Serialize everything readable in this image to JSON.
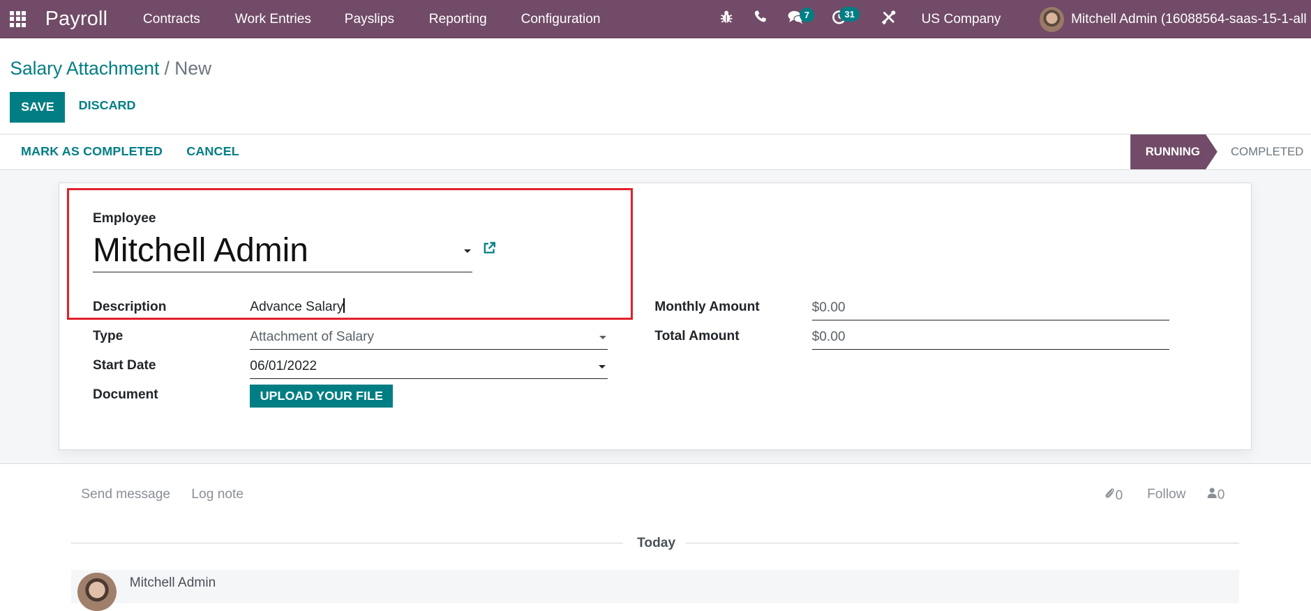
{
  "navbar": {
    "brand": "Payroll",
    "menu": [
      "Contracts",
      "Work Entries",
      "Payslips",
      "Reporting",
      "Configuration"
    ],
    "icons": [
      "apps-grid-icon",
      "bug-icon",
      "phone-icon",
      "chat-bubbles-icon",
      "activity-clock-icon",
      "tools-icon"
    ],
    "messages_badge": "7",
    "activities_badge": "31",
    "company": "US Company",
    "user": "Mitchell Admin (16088564-saas-15-1-all"
  },
  "breadcrumb": {
    "parent": "Salary Attachment",
    "separator": "/",
    "current": "New"
  },
  "actions": {
    "save": "SAVE",
    "discard": "DISCARD"
  },
  "statusbar": {
    "buttons": [
      "MARK AS COMPLETED",
      "CANCEL"
    ],
    "stages": [
      {
        "label": "RUNNING",
        "active": true
      },
      {
        "label": "COMPLETED",
        "active": false
      }
    ]
  },
  "form": {
    "employee_label": "Employee",
    "employee_value": "Mitchell Admin",
    "fields_left": [
      {
        "label": "Description",
        "value": "Advance Salary"
      },
      {
        "label": "Type",
        "value": "Attachment of Salary"
      },
      {
        "label": "Start Date",
        "value": "06/01/2022"
      },
      {
        "label": "Document",
        "value": "UPLOAD YOUR FILE"
      }
    ],
    "fields_right": [
      {
        "label": "Monthly Amount",
        "value": "$0.00"
      },
      {
        "label": "Total Amount",
        "value": "$0.00"
      }
    ],
    "highlight_color": "#e2202b"
  },
  "chatter": {
    "send_message": "Send message",
    "log_note": "Log note",
    "attachments_count": "0",
    "follow": "Follow",
    "followers_count": "0",
    "date_separator": "Today",
    "messages": [
      {
        "author": "Mitchell Admin"
      }
    ]
  },
  "colors": {
    "brand": "#714b67",
    "accent": "#017e84"
  }
}
